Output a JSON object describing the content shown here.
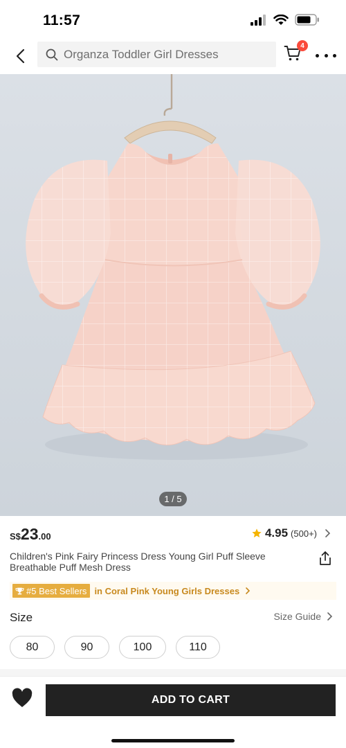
{
  "status_bar": {
    "time": "11:57"
  },
  "header": {
    "search_placeholder": "Organza Toddler Girl Dresses",
    "cart_count": "4"
  },
  "gallery": {
    "counter": "1 / 5"
  },
  "product": {
    "currency": "S$",
    "price_int": "23",
    "price_dec": ".00",
    "rating": "4.95",
    "review_count": "(500+)",
    "title": "Children's Pink Fairy Princess Dress Young Girl Puff Sleeve Breathable Puff Mesh Dress"
  },
  "best_seller": {
    "badge": "#5 Best Sellers",
    "category": "in Coral Pink Young Girls Dresses"
  },
  "size": {
    "label": "Size",
    "guide": "Size Guide",
    "options": [
      "80",
      "90",
      "100",
      "110"
    ]
  },
  "bottom_bar": {
    "add_to_cart": "ADD TO CART"
  },
  "colors": {
    "accent": "#222222",
    "badge_red": "#fa4a3b",
    "best_seller_gold": "#e6ad3f",
    "star": "#f5b400",
    "dress_pink": "#f6d2c8"
  },
  "icons": [
    "back-arrow-icon",
    "search-icon",
    "cart-icon",
    "more-icon",
    "star-icon",
    "chevron-right-icon",
    "share-icon",
    "trophy-icon",
    "heart-icon"
  ]
}
